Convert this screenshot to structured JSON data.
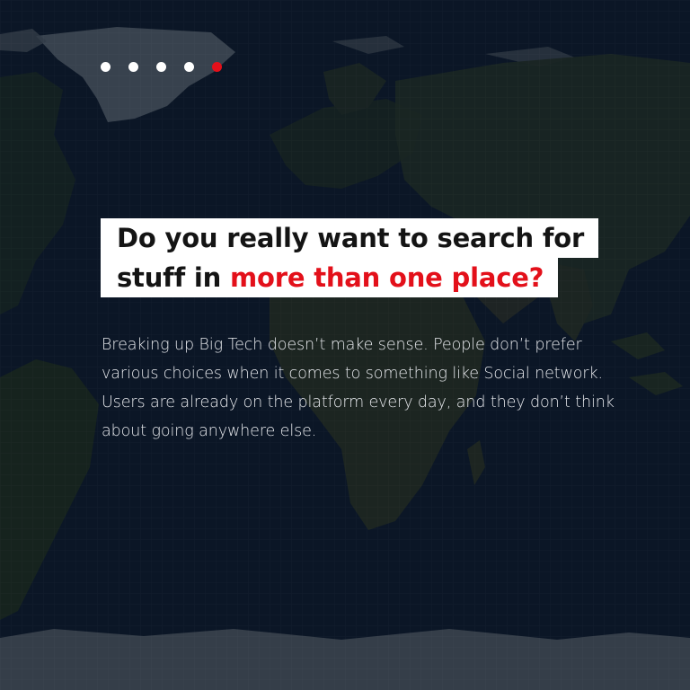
{
  "pager": {
    "dots": [
      {
        "active": false
      },
      {
        "active": false
      },
      {
        "active": false
      },
      {
        "active": false
      },
      {
        "active": true
      }
    ],
    "active_color": "#e3101a",
    "inactive_color": "#ffffff"
  },
  "headline": {
    "line1": "Do you really want to search for",
    "line2_prefix": "stuff in ",
    "line2_highlight": "more than one place?",
    "highlight_color": "#e3101a"
  },
  "body": {
    "text": "Breaking up Big Tech doesn’t make sense. People don’t prefer various choices when it comes to something like Social network. Users are already on the platform every day, and they don’t think about going anywhere else."
  }
}
